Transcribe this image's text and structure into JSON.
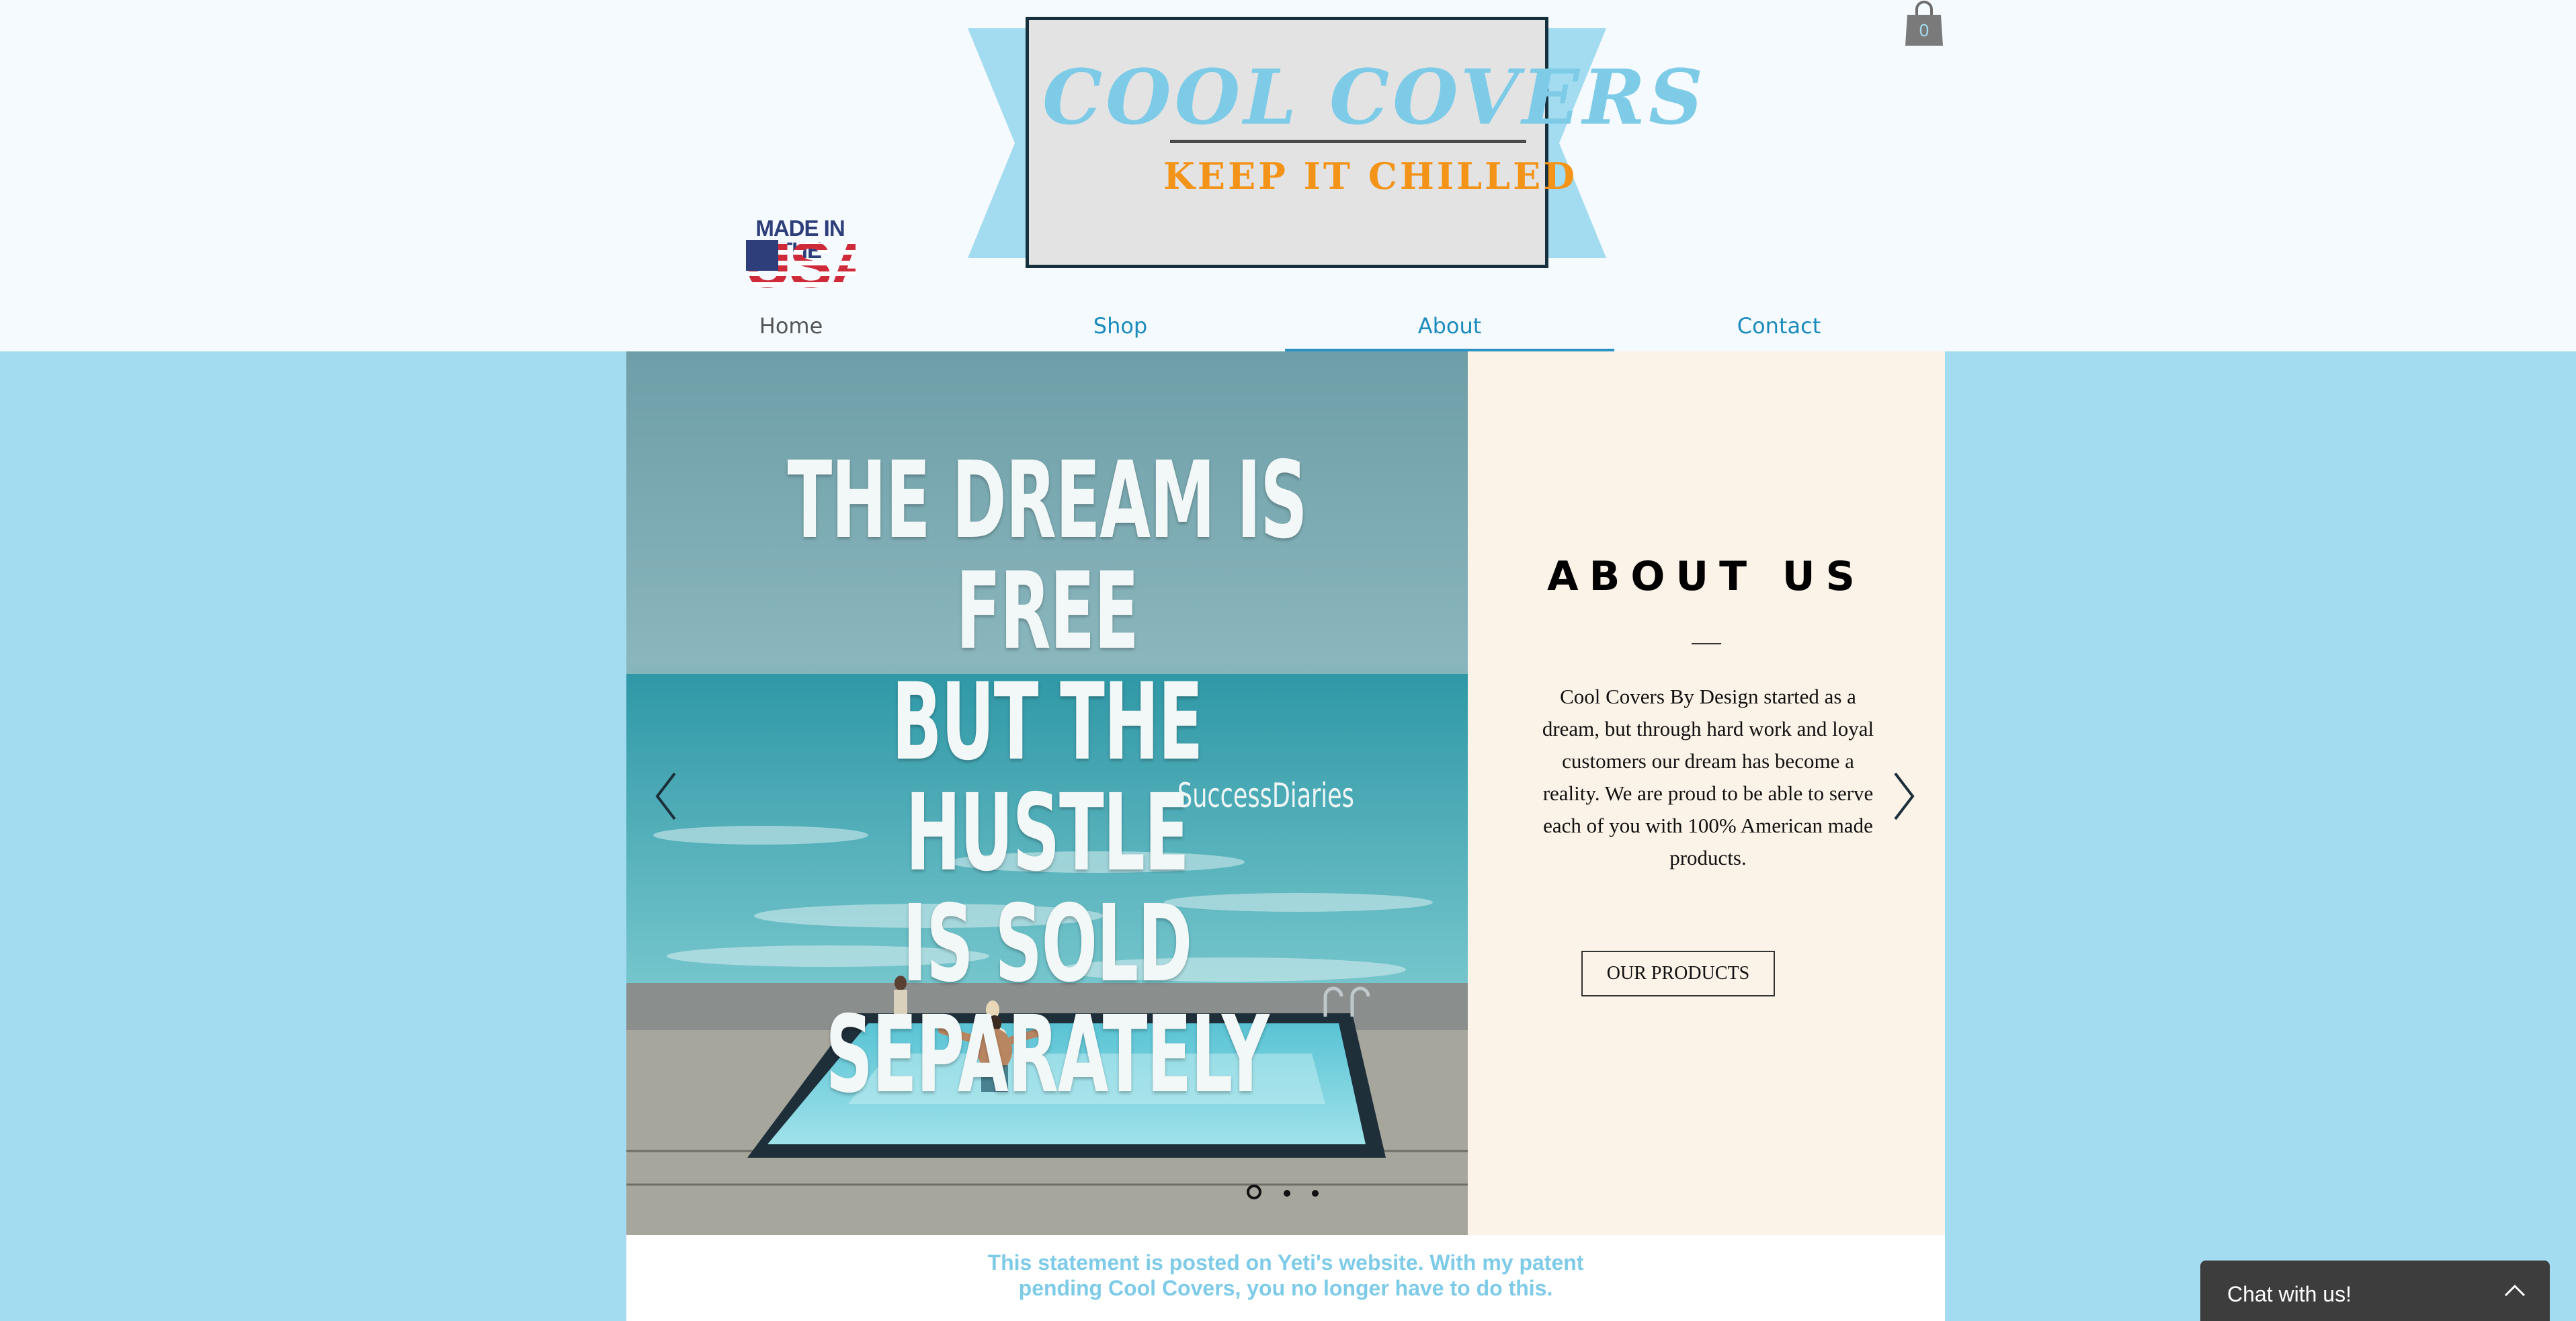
{
  "header": {
    "logo_title": "COOL COVERS",
    "logo_tagline": "KEEP IT CHILLED",
    "usa_badge_top": "MADE IN THE",
    "usa_badge_big": "USA",
    "cart_count": "0"
  },
  "nav": {
    "items": [
      {
        "label": "Home"
      },
      {
        "label": "Shop"
      },
      {
        "label": "About"
      },
      {
        "label": "Contact"
      }
    ],
    "active": "About"
  },
  "hero": {
    "quote_lines": [
      "THE DREAM IS FREE",
      "BUT THE HUSTLE",
      "IS SOLD SEPARATELY"
    ],
    "quote_credit": "SuccessDiaries",
    "slide_count": 3,
    "active_slide": 1
  },
  "about": {
    "heading": "ABOUT US",
    "body": "Cool Covers By Design started as a dream, but through hard work and loyal customers our dream has become a reality. We are proud to be able to serve each of you with 100% American made products.",
    "button_label": "OUR PRODUCTS"
  },
  "statement": {
    "line1": "This statement is posted on Yeti's website. With my patent",
    "line2": "pending Cool Covers, you no longer have to do this."
  },
  "chat": {
    "label": "Chat with us!"
  },
  "colors": {
    "page_background": "#a3dcf0",
    "header_background": "#f4fafd",
    "brand_blue": "#7ecbe8",
    "nav_link": "#1c8cbe",
    "tagline_orange": "#f39318",
    "about_panel": "#fcf3e8",
    "chat_background": "#3d3d3d"
  },
  "icons": [
    "shopping-bag-icon",
    "chevron-left-icon",
    "chevron-right-icon",
    "chevron-up-icon"
  ]
}
